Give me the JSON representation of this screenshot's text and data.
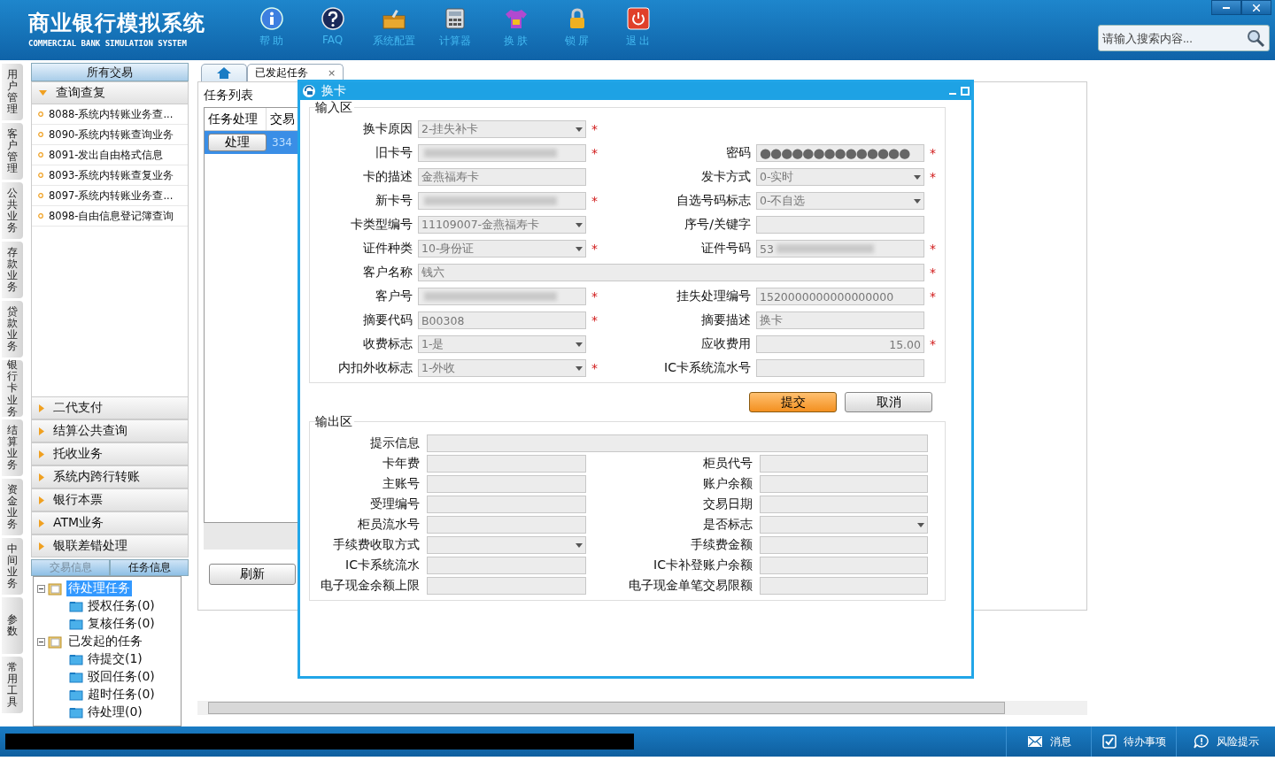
{
  "header": {
    "title": "商业银行模拟系统",
    "subtitle": "COMMERCIAL BANK SIMULATION SYSTEM",
    "toolbar": [
      {
        "kind": "help",
        "label": "帮 助"
      },
      {
        "kind": "faq",
        "label": "FAQ"
      },
      {
        "kind": "config",
        "label": "系统配置"
      },
      {
        "kind": "calculator",
        "label": "计算器"
      },
      {
        "kind": "skin",
        "label": "换 肤"
      },
      {
        "kind": "lock",
        "label": "锁 屏"
      },
      {
        "kind": "exit",
        "label": "退 出"
      }
    ],
    "search": {
      "placeholder": "请输入搜索内容..."
    }
  },
  "side_tabs": [
    "用户管理",
    "客户管理",
    "公共业务",
    "存款业务",
    "贷款业务",
    "银行卡业务",
    "结算业务",
    "资金业务",
    "中间业务",
    "参数",
    "常用工具"
  ],
  "transactions": {
    "title": "所有交易",
    "sections": [
      {
        "label": "查询查复",
        "expanded": true,
        "items": [
          "8088-系统内转账业务查...",
          "8090-系统内转账查询业务",
          "8091-发出自由格式信息",
          "8093-系统内转账查复业务",
          "8097-系统内转账业务查...",
          "8098-自由信息登记簿查询"
        ]
      },
      {
        "label": "二代支付",
        "expanded": false
      },
      {
        "label": "结算公共查询",
        "expanded": false
      },
      {
        "label": "托收业务",
        "expanded": false
      },
      {
        "label": "系统内跨行转账",
        "expanded": false
      },
      {
        "label": "银行本票",
        "expanded": false
      },
      {
        "label": "ATM业务",
        "expanded": false
      },
      {
        "label": "银联差错处理",
        "expanded": false
      }
    ]
  },
  "info_tabs": [
    {
      "label": "交易信息",
      "selected": false
    },
    {
      "label": "任务信息",
      "selected": true
    }
  ],
  "task_tree": [
    {
      "label": "待处理任务",
      "selected": true,
      "expanded": true,
      "children": [
        {
          "label": "授权任务(0)",
          "selected": false
        },
        {
          "label": "复核任务(0)",
          "selected": false
        }
      ]
    },
    {
      "label": "已发起的任务",
      "selected": false,
      "expanded": true,
      "children": [
        {
          "label": "待提交(1)",
          "selected": false
        },
        {
          "label": "驳回任务(0)",
          "selected": false
        },
        {
          "label": "超时任务(0)",
          "selected": false
        },
        {
          "label": "待处理(0)",
          "selected": false
        }
      ]
    }
  ],
  "main_tabs": [
    {
      "kind": "home",
      "selected": false
    },
    {
      "kind": "text",
      "label": "已发起任务",
      "close": "×",
      "selected": true
    }
  ],
  "task_list": {
    "title": "任务列表",
    "columns": [
      "任务处理",
      "交易"
    ],
    "rows": [
      {
        "action": "处理",
        "column_2": "334",
        "selected": true
      }
    ],
    "refresh": "刷新"
  },
  "dialog": {
    "title": "换卡",
    "input_area": {
      "title": "输入区",
      "rows": [
        [
          {
            "label": "换卡原因",
            "kind": "select",
            "value": "2-挂失补卡",
            "required_mark": "*",
            "redacted": false
          }
        ],
        [
          {
            "label": "旧卡号",
            "kind": "text",
            "required_mark": "*",
            "redacted": true
          },
          {
            "label": "密码",
            "kind": "password",
            "value": "●●●●●●●●●●●●●●",
            "required_mark": "*",
            "redacted": false
          }
        ],
        [
          {
            "label": "卡的描述",
            "kind": "text",
            "value": "金燕福寿卡",
            "redacted": false
          },
          {
            "label": "发卡方式",
            "kind": "select",
            "value": "0-实时",
            "required_mark": "*",
            "redacted": false
          }
        ],
        [
          {
            "label": "新卡号",
            "kind": "text",
            "required_mark": "*",
            "redacted": true
          },
          {
            "label": "自选号码标志",
            "kind": "select",
            "value": "0-不自选",
            "redacted": false
          }
        ],
        [
          {
            "label": "卡类型编号",
            "kind": "select",
            "value": "11109007-金燕福寿卡",
            "redacted": false
          },
          {
            "label": "序号/关键字",
            "kind": "text",
            "redacted": false
          }
        ],
        [
          {
            "label": "证件种类",
            "kind": "select",
            "value": "10-身份证",
            "required_mark": "*",
            "redacted": false
          },
          {
            "label": "证件号码",
            "kind": "text",
            "value": "53",
            "required_mark": "*",
            "redacted": true
          }
        ],
        [
          {
            "label": "客户名称",
            "kind": "wide",
            "value": "钱六",
            "required_mark": "*",
            "redacted": false
          }
        ],
        [
          {
            "label": "客户号",
            "kind": "text",
            "required_mark": "*",
            "redacted": true
          },
          {
            "label": "挂失处理编号",
            "kind": "text",
            "value": "1520000000000000000",
            "required_mark": "*",
            "redacted": false
          }
        ],
        [
          {
            "label": "摘要代码",
            "kind": "text",
            "value": "B00308",
            "required_mark": "*",
            "redacted": false
          },
          {
            "label": "摘要描述",
            "kind": "text",
            "value": "换卡",
            "redacted": false
          }
        ],
        [
          {
            "label": "收费标志",
            "kind": "select",
            "value": "1-是",
            "redacted": false
          },
          {
            "label": "应收费用",
            "kind": "amount",
            "value": "15.00",
            "required_mark": "*",
            "redacted": false
          }
        ],
        [
          {
            "label": "内扣外收标志",
            "kind": "select",
            "value": "1-外收",
            "required_mark": "*",
            "redacted": false
          },
          {
            "label": "IC卡系统流水号",
            "kind": "text",
            "redacted": false
          }
        ]
      ]
    },
    "buttons": [
      {
        "label": "提交",
        "focused": true
      },
      {
        "label": "取消",
        "focused": false
      }
    ],
    "output_area": {
      "title": "输出区",
      "rows": [
        [
          {
            "label": "提示信息",
            "kind": "wide"
          }
        ],
        [
          {
            "label": "卡年费",
            "kind": "text"
          },
          {
            "label": "柜员代号",
            "kind": "text"
          }
        ],
        [
          {
            "label": "主账号",
            "kind": "text"
          },
          {
            "label": "账户余额",
            "kind": "text"
          }
        ],
        [
          {
            "label": "受理编号",
            "kind": "text"
          },
          {
            "label": "交易日期",
            "kind": "text"
          }
        ],
        [
          {
            "label": "柜员流水号",
            "kind": "text"
          },
          {
            "label": "是否标志",
            "kind": "select"
          }
        ],
        [
          {
            "label": "手续费收取方式",
            "kind": "select"
          },
          {
            "label": "手续费金额",
            "kind": "text"
          }
        ],
        [
          {
            "label": "IC卡系统流水",
            "kind": "text"
          },
          {
            "label": "IC卡补登账户余额",
            "kind": "text"
          }
        ],
        [
          {
            "label": "电子现金余额上限",
            "kind": "text"
          },
          {
            "label": "电子现金单笔交易限额",
            "kind": "text"
          }
        ]
      ]
    }
  },
  "status_bar": {
    "items": [
      {
        "kind": "message",
        "label": "消息"
      },
      {
        "kind": "todo",
        "label": "待办事项"
      },
      {
        "kind": "risk",
        "label": "风险提示"
      }
    ]
  }
}
